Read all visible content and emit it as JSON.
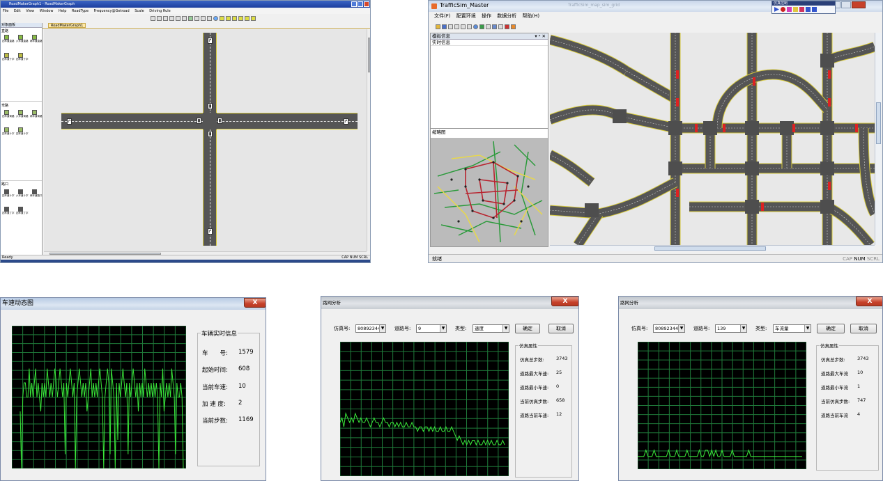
{
  "roadmaker": {
    "title": "RoadMakerGraph1 - RoadMakerGraph",
    "menu": [
      "File",
      "Edit",
      "View",
      "Window",
      "Help",
      "RoadType",
      "Frequency@Getroad",
      "Scale",
      "Driving Rule"
    ],
    "doc_tab": "RoadMakerGraph1",
    "palette_title": "对象面板",
    "sections": [
      {
        "label": "直路",
        "items": [
          "四车道直路",
          "六车道直路",
          "两车道直路",
          "四车道十字"
        ]
      },
      {
        "label": "弯路",
        "items": [
          "四车道弯路",
          "六车道弯路",
          "两车道弯路",
          "四车道十字"
        ]
      },
      {
        "label": "路口",
        "items": [
          "四车道十字",
          "六车道十字",
          "两车道路口",
          "四车道丁字"
        ]
      }
    ],
    "status_left": "Ready",
    "status_right": "CAP NUM SCRL"
  },
  "trafficsim": {
    "title": "TrafficSim_Master",
    "faded_caption": "TrafficSim_map_sim_grid",
    "menu": [
      "文件(F)",
      "配置环境",
      "操作",
      "数据分析",
      "帮助(H)"
    ],
    "float_toolbar_title": "仿真控制",
    "panel_title": "模拟信息",
    "panel_controls": "▾ ᵖ ✕",
    "realtime_label": "实时信息",
    "thumbnail_label": "缩略图",
    "status_left": "就绪",
    "status_right": [
      "CAP",
      "NUM",
      "SCRL"
    ]
  },
  "speed_dialog": {
    "title": "车速动态图",
    "close_label": "X",
    "group_title": "车辆实时信息",
    "rows": [
      {
        "label": "车　　号:",
        "value": "1579"
      },
      {
        "label": "起始时间:",
        "value": "608"
      },
      {
        "label": "当前车速:",
        "value": "10"
      },
      {
        "label": "加 速 度:",
        "value": "2"
      },
      {
        "label": "当前步数:",
        "value": "1169"
      }
    ]
  },
  "road_dialog_speed": {
    "title": "路网分析",
    "close_label": "X",
    "sim_label": "仿真号:",
    "sim_value": "808923443",
    "road_label": "道路号:",
    "road_value": "9",
    "type_label": "类型:",
    "type_value": "速度",
    "ok_label": "确定",
    "cancel_label": "取消",
    "group_title": "仿真属性",
    "rows": [
      {
        "label": "仿真总步数:",
        "value": "3743"
      },
      {
        "label": "道路最大车速:",
        "value": "25"
      },
      {
        "label": "道路最小车速:",
        "value": "0"
      },
      {
        "label": "当前仿真步数:",
        "value": "658"
      },
      {
        "label": "道路当前车速:",
        "value": "12"
      }
    ]
  },
  "road_dialog_flow": {
    "title": "路网分析",
    "close_label": "X",
    "sim_label": "仿真号:",
    "sim_value": "808923443",
    "road_label": "道路号:",
    "road_value": "139",
    "type_label": "类型:",
    "type_value": "车流量",
    "ok_label": "确定",
    "cancel_label": "取消",
    "group_title": "仿真属性",
    "rows": [
      {
        "label": "仿真总步数:",
        "value": "3743"
      },
      {
        "label": "道路最大车流",
        "value": "10"
      },
      {
        "label": "道路最小车流",
        "value": "1"
      },
      {
        "label": "当前仿真步数:",
        "value": "747"
      },
      {
        "label": "道路当前车流",
        "value": "4"
      }
    ]
  },
  "colors": {
    "plot_bg": "#000000",
    "grid": "#1f7a3a",
    "trace": "#39e639",
    "road": "#555555",
    "road_edge": "#d6c93a",
    "close_red": "#c6412a"
  },
  "chart_data": [
    {
      "type": "line",
      "title": "车速动态图",
      "xlabel": "",
      "ylabel": "",
      "grid": true,
      "series": [
        {
          "values": [
            4,
            0,
            5,
            6,
            6,
            5,
            5,
            7,
            5,
            6,
            5,
            6,
            7,
            5,
            6,
            5,
            4,
            6,
            5,
            6,
            5,
            7,
            6,
            5,
            6,
            5,
            6,
            7,
            6,
            5,
            6,
            7,
            6,
            5,
            6,
            1,
            6,
            5,
            6,
            7,
            6,
            5,
            6,
            0,
            5,
            6,
            7,
            6,
            5,
            6,
            5,
            6,
            4,
            5,
            6,
            7,
            5,
            6,
            5,
            6,
            5,
            6,
            7,
            6,
            5,
            0,
            5,
            6,
            7,
            6,
            1,
            7,
            6,
            5,
            0,
            6,
            2,
            6,
            5,
            6,
            7,
            6,
            5,
            6,
            1,
            6,
            5,
            6,
            7,
            6,
            5,
            6,
            4,
            6,
            5,
            6,
            5,
            7,
            6,
            5,
            6,
            5,
            6,
            5,
            6,
            5,
            6,
            5,
            0,
            6,
            5,
            7,
            4,
            5,
            6,
            5,
            6,
            5,
            7,
            6,
            5,
            1,
            6,
            5,
            5,
            6,
            5,
            0
          ]
        }
      ]
    },
    {
      "type": "line",
      "title": "",
      "xlabel": "",
      "ylabel": "",
      "grid": true,
      "series": [
        {
          "values": [
            12,
            13,
            11,
            14,
            13,
            12,
            13,
            12,
            14,
            13,
            12,
            13,
            12,
            12,
            13,
            12,
            11,
            12,
            13,
            12,
            12,
            11,
            12,
            13,
            12,
            12,
            11,
            12,
            12,
            11,
            12,
            11,
            12,
            11,
            11,
            12,
            11,
            11,
            12,
            11,
            11,
            10,
            11,
            11,
            10,
            11,
            11,
            10,
            11,
            10,
            11,
            10,
            10,
            11,
            10,
            10,
            11,
            10,
            10,
            11,
            10,
            9,
            8,
            9,
            8,
            7,
            8,
            7,
            8,
            7,
            8,
            8,
            7,
            8,
            7,
            7,
            8,
            7,
            8,
            7,
            8,
            7,
            7,
            8,
            7,
            7,
            8,
            7
          ]
        }
      ]
    },
    {
      "type": "line",
      "title": "",
      "xlabel": "",
      "ylabel": "",
      "grid": true,
      "series": [
        {
          "values": [
            2,
            2,
            2,
            2,
            3,
            2,
            2,
            2,
            3,
            2,
            2,
            2,
            2,
            2,
            2,
            3,
            2,
            2,
            2,
            3,
            2,
            2,
            2,
            2,
            3,
            2,
            2,
            2,
            2,
            2,
            3,
            2,
            2,
            3,
            3,
            2,
            3,
            2,
            3,
            2,
            2,
            3,
            2,
            2,
            2,
            2,
            3,
            2,
            2,
            2,
            2,
            2,
            2,
            2,
            3,
            2,
            2,
            2,
            2,
            2,
            2,
            2,
            2,
            2,
            2,
            2,
            2,
            2,
            2,
            2,
            2,
            2,
            2,
            2,
            2,
            2,
            2,
            2,
            2,
            2,
            2
          ]
        }
      ]
    }
  ]
}
